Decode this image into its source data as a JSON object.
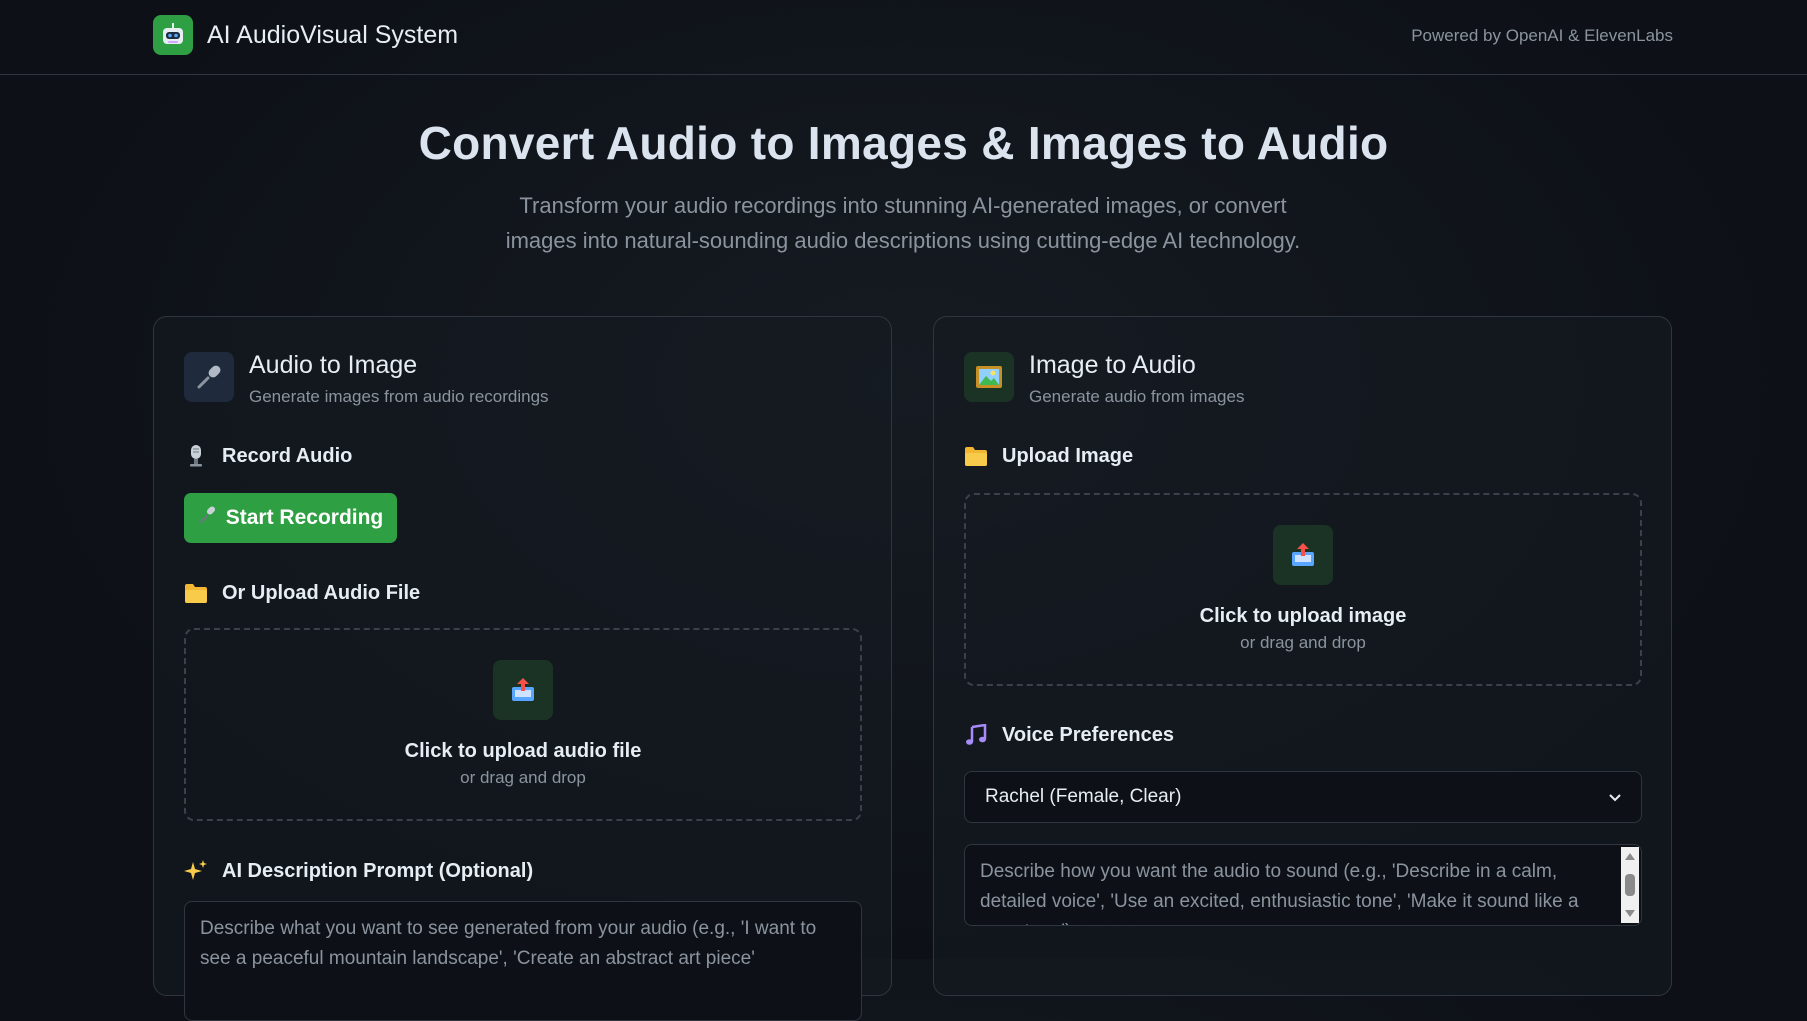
{
  "header": {
    "app_title": "AI AudioVisual System",
    "powered_by": "Powered by OpenAI & ElevenLabs",
    "logo_icon": "robot-icon"
  },
  "hero": {
    "title": "Convert Audio to Images & Images to Audio",
    "subtitle_line1": "Transform your audio recordings into stunning AI-generated images, or convert",
    "subtitle_line2": "images into natural-sounding audio descriptions using cutting-edge AI technology."
  },
  "audio_to_image": {
    "icon": "microphone-icon",
    "title": "Audio to Image",
    "subtitle": "Generate images from audio recordings",
    "record_label": "Record Audio",
    "record_button": "Start Recording",
    "upload_label": "Or Upload Audio File",
    "dropzone_title": "Click to upload audio file",
    "dropzone_sub": "or drag and drop",
    "prompt_label": "AI Description Prompt (Optional)",
    "prompt_placeholder": "Describe what you want to see generated from your audio (e.g., 'I want to see a peaceful mountain landscape', 'Create an abstract art piece'"
  },
  "image_to_audio": {
    "icon": "framed-picture-icon",
    "title": "Image to Audio",
    "subtitle": "Generate audio from images",
    "upload_label": "Upload Image",
    "dropzone_title": "Click to upload image",
    "dropzone_sub": "or drag and drop",
    "voice_label": "Voice Preferences",
    "voice_selected": "Rachel (Female, Clear)",
    "style_placeholder": "Describe how you want the audio to sound (e.g., 'Describe in a calm, detailed voice', 'Use an excited, enthusiastic tone', 'Make it sound like a narrator...')"
  },
  "colors": {
    "background": "#0d1117",
    "accent_green": "#2ea043",
    "border": "#30363d",
    "muted_text": "#8b949e"
  }
}
